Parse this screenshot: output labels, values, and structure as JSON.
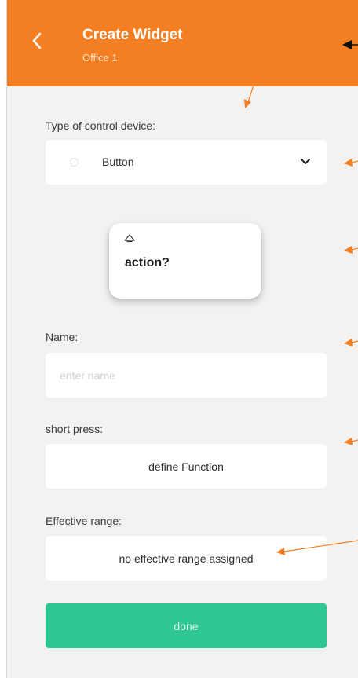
{
  "header": {
    "title": "Create Widget",
    "subtitle": "Office 1"
  },
  "control_device": {
    "label": "Type of control device:",
    "value": "Button"
  },
  "preview": {
    "text": "action?"
  },
  "name_field": {
    "label": "Name:",
    "value": "",
    "placeholder": "enter name"
  },
  "short_press": {
    "label": "short press:",
    "button": "define Function"
  },
  "effective_range": {
    "label": "Effective range:",
    "button": "no effective range assigned"
  },
  "done_button": {
    "label": "done"
  },
  "colors": {
    "header": "#f47f22",
    "done": "#2fc794",
    "background": "#f4f2f0",
    "annotation_arrows": "#f47f22"
  }
}
